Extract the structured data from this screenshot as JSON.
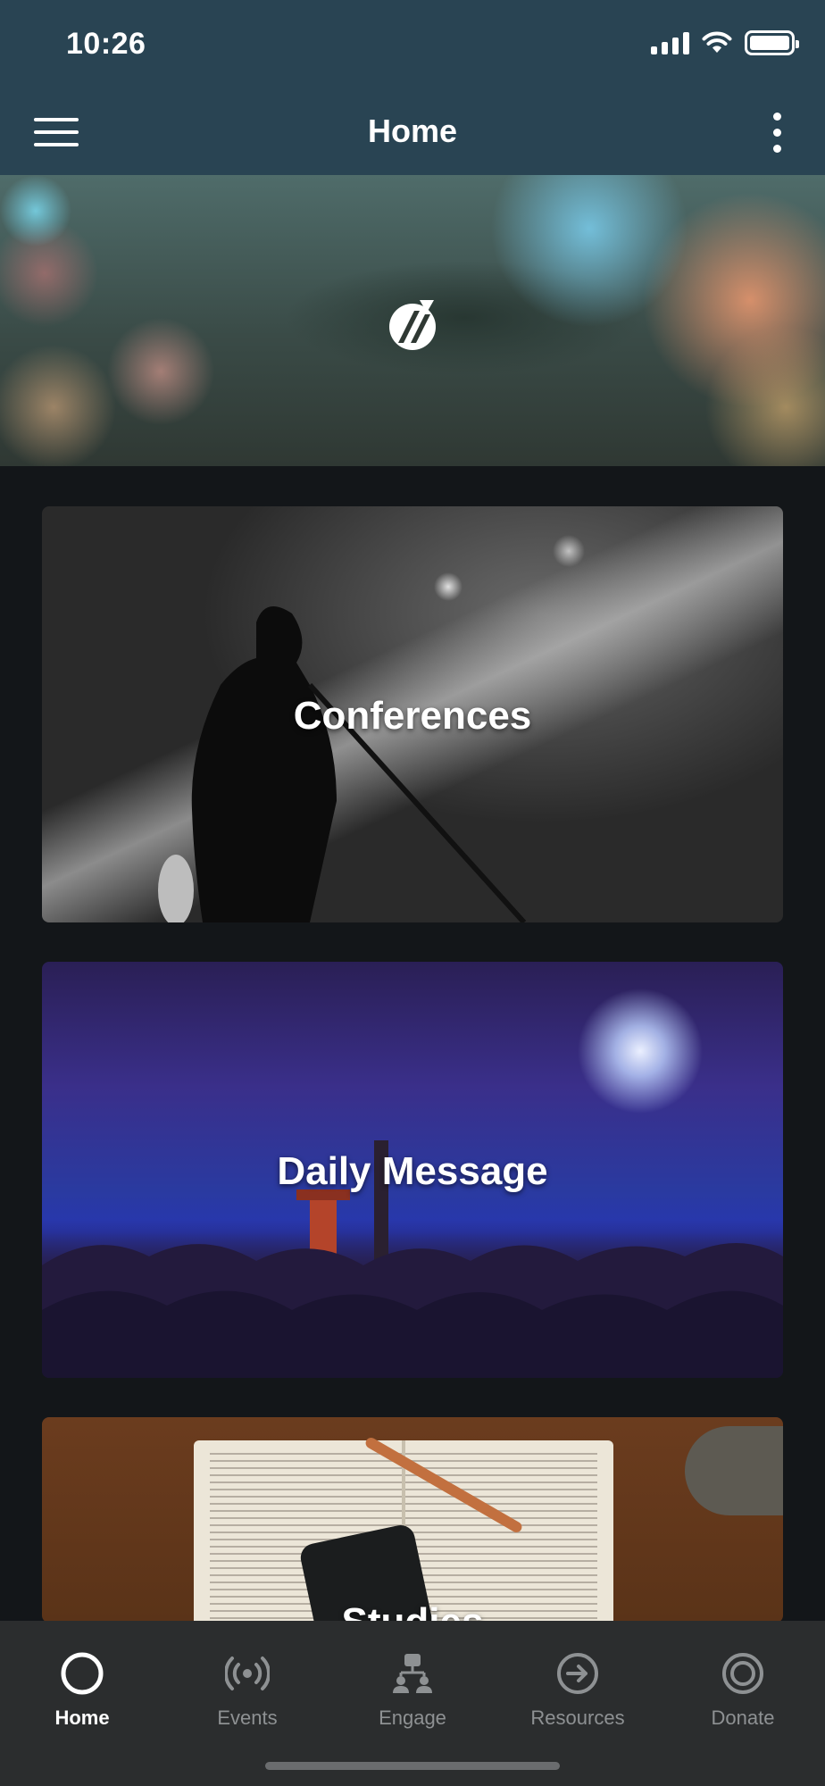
{
  "status_bar": {
    "time": "10:26"
  },
  "header": {
    "title": "Home"
  },
  "cards": [
    {
      "label": "Conferences"
    },
    {
      "label": "Daily Message"
    },
    {
      "label": "Studies"
    }
  ],
  "bottom_nav": [
    {
      "label": "Home",
      "icon": "home-circle-icon",
      "active": true
    },
    {
      "label": "Events",
      "icon": "broadcast-icon",
      "active": false
    },
    {
      "label": "Engage",
      "icon": "people-network-icon",
      "active": false
    },
    {
      "label": "Resources",
      "icon": "arrow-circle-icon",
      "active": false
    },
    {
      "label": "Donate",
      "icon": "target-circle-icon",
      "active": false
    }
  ],
  "colors": {
    "header": "#294453",
    "background": "#131619",
    "nav": "#2b2d2e"
  }
}
